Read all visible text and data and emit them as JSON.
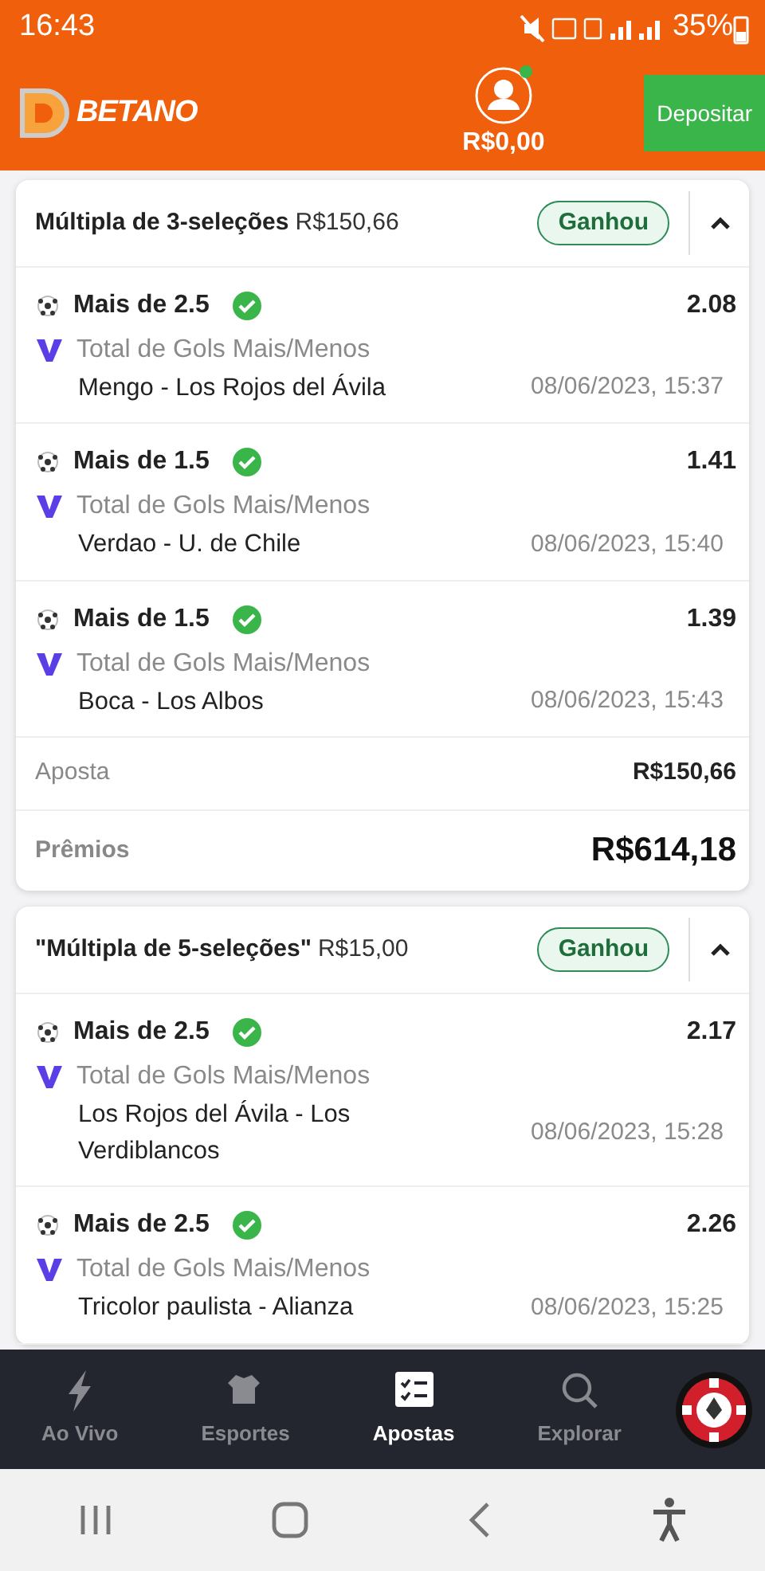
{
  "status_bar": {
    "time": "16:43",
    "battery": "35%"
  },
  "header": {
    "logo": "BETANO",
    "balance": "R$0,00",
    "deposit_button": "Depositar",
    "online": true
  },
  "bets": [
    {
      "title": "Múltipla de 3-seleções",
      "amount": "R$150,66",
      "status": "Ganhou",
      "expanded": true,
      "selections": [
        {
          "pick": "Mais de 2.5",
          "won": true,
          "odds": "2.08",
          "market": "Total de Gols Mais/Menos",
          "match": "Mengo - Los Rojos del Ávila",
          "date": "08/06/2023, 15:37"
        },
        {
          "pick": "Mais de 1.5",
          "won": true,
          "odds": "1.41",
          "market": "Total de Gols Mais/Menos",
          "match": "Verdao - U. de Chile",
          "date": "08/06/2023, 15:40"
        },
        {
          "pick": "Mais de 1.5",
          "won": true,
          "odds": "1.39",
          "market": "Total de Gols Mais/Menos",
          "match": "Boca - Los Albos",
          "date": "08/06/2023, 15:43"
        }
      ],
      "summary": [
        {
          "label": "Aposta",
          "value": "R$150,66",
          "kind": "stake"
        },
        {
          "label": "Prêmios",
          "value": "R$614,18",
          "kind": "prize"
        }
      ]
    },
    {
      "title": "\"Múltipla de 5-seleções\"",
      "amount": "R$15,00",
      "status": "Ganhou",
      "expanded": true,
      "selections": [
        {
          "pick": "Mais de 2.5",
          "won": true,
          "odds": "2.17",
          "market": "Total de Gols Mais/Menos",
          "match": "Los Rojos del Ávila - Los Verdiblancos",
          "date": "08/06/2023, 15:28"
        },
        {
          "pick": "Mais de 2.5",
          "won": true,
          "odds": "2.26",
          "market": "Total de Gols Mais/Menos",
          "match": "Tricolor paulista - Alianza",
          "date": "08/06/2023, 15:25"
        }
      ]
    }
  ],
  "bottom_nav": [
    {
      "label": "Ao Vivo",
      "kind": "live",
      "selected": false
    },
    {
      "label": "Esportes",
      "kind": "sports",
      "selected": false
    },
    {
      "label": "Apostas",
      "kind": "bets",
      "selected": true
    },
    {
      "label": "Explorar",
      "kind": "explore",
      "selected": false
    },
    {
      "kind": "casino"
    }
  ]
}
